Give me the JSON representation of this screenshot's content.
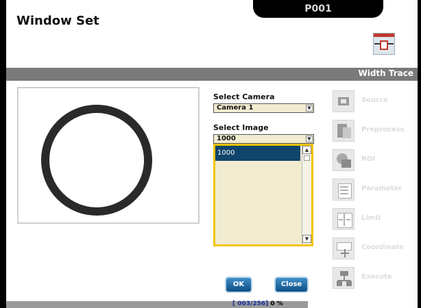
{
  "header": {
    "title": "Window Set",
    "program": "P001",
    "icon": "window-set-icon"
  },
  "main": {
    "section_title": "Width Trace"
  },
  "camera": {
    "label": "Select Camera",
    "value": "Camera 1"
  },
  "image": {
    "label": "Select Image",
    "value": "1000",
    "list": [
      "1000"
    ]
  },
  "buttons": {
    "ok": "OK",
    "close": "Close"
  },
  "nav": [
    {
      "label": "Source",
      "icon": "source-icon"
    },
    {
      "label": "Preprocess",
      "icon": "preprocess-icon"
    },
    {
      "label": "ROI",
      "icon": "roi-icon"
    },
    {
      "label": "Parameter",
      "icon": "parameter-icon"
    },
    {
      "label": "Limit",
      "icon": "limit-icon"
    },
    {
      "label": "Coordinate",
      "icon": "coordinate-icon"
    },
    {
      "label": "Execute",
      "icon": "execute-icon"
    }
  ],
  "status": {
    "count": "[ 003/256]",
    "percent": "0 %"
  },
  "colors": {
    "accent": "#10456b",
    "highlight": "#f2c400",
    "field": "#f1ecd0"
  }
}
